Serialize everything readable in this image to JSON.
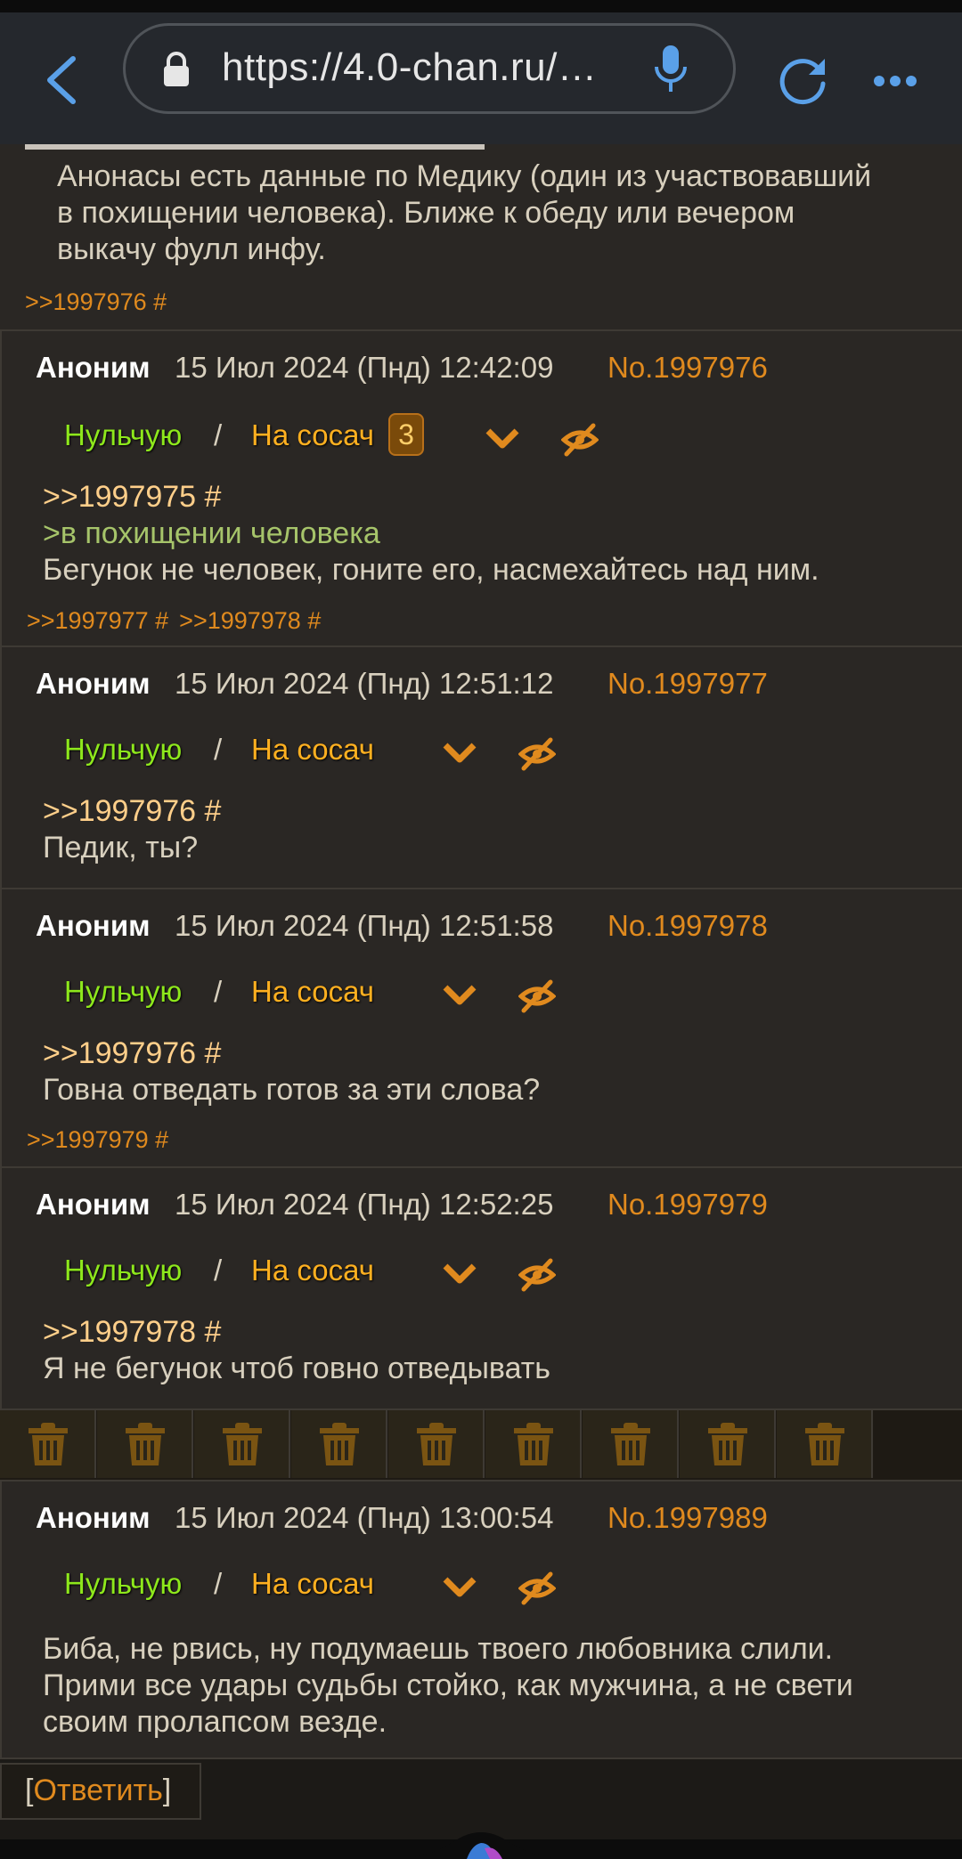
{
  "browser": {
    "url": "https://4.0-chan.ru/…"
  },
  "first_post": {
    "message": "Анонасы есть данные по Медику (один из участвовавший\nв похищении человека). Ближе к обеду или вечером\nвыкачу фулл инфу.",
    "backlinks": [
      ">>1997976 #"
    ]
  },
  "posts": [
    {
      "name": "Аноним",
      "date": "15 Июл 2024 (Пнд) 12:42:09",
      "number": "No.1997976",
      "action_left": "Нульчую",
      "separator": "/",
      "action_right": "На сосач",
      "badge": "3",
      "reply": ">>1997975 #",
      "quote": ">в похищении человека",
      "text": "Бегунок не человек, гоните его, насмехайтесь над ним.",
      "backlinks": [
        ">>1997977 #",
        ">>1997978 #"
      ]
    },
    {
      "name": "Аноним",
      "date": "15 Июл 2024 (Пнд) 12:51:12",
      "number": "No.1997977",
      "action_left": "Нульчую",
      "separator": "/",
      "action_right": "На сосач",
      "reply": ">>1997976 #",
      "text": "Педик, ты?"
    },
    {
      "name": "Аноним",
      "date": "15 Июл 2024 (Пнд) 12:51:58",
      "number": "No.1997978",
      "action_left": "Нульчую",
      "separator": "/",
      "action_right": "На сосач",
      "reply": ">>1997976 #",
      "text": "Говна отведать готов за эти слова?",
      "backlinks": [
        ">>1997979 #"
      ]
    },
    {
      "name": "Аноним",
      "date": "15 Июл 2024 (Пнд) 12:52:25",
      "number": "No.1997979",
      "action_left": "Нульчую",
      "separator": "/",
      "action_right": "На сосач",
      "reply": ">>1997978 #",
      "text": "Я не бегунок чтоб говно отведывать"
    },
    {
      "name": "Аноним",
      "date": "15 Июл 2024 (Пнд) 13:00:54",
      "number": "No.1997989",
      "action_left": "Нульчую",
      "separator": "/",
      "action_right": "На сосач",
      "text": "Биба, не рвись, ну подумаешь твоего любовника слили.\nПрими все удары судьбы стойко, как мужчина, а не свети\nсвоим пролапсом везде."
    }
  ],
  "hidden_posts_count": 9,
  "reply_button": {
    "open": "[",
    "label": "Ответить",
    "close": "]"
  },
  "colors": {
    "accent": "#e08a1e",
    "green": "#8ee81c",
    "quote": "#a6c46a",
    "background": "#2a2724"
  }
}
